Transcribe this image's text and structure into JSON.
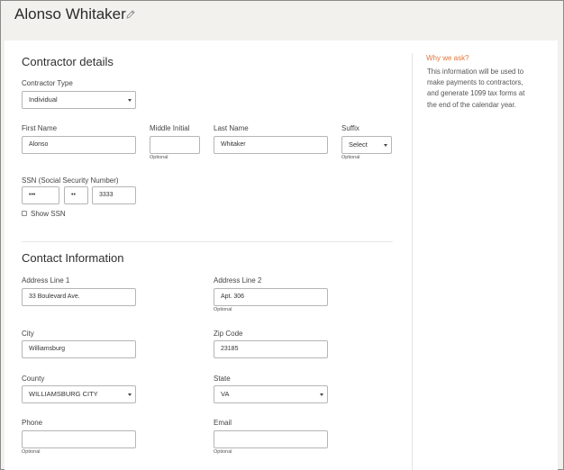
{
  "header": {
    "name": "Alonso Whitaker",
    "edit_icon": "pencil-icon"
  },
  "contractor": {
    "title": "Contractor details",
    "type_label": "Contractor Type",
    "type_value": "Individual",
    "first_name_label": "First Name",
    "first_name_value": "Alonso",
    "middle_initial_label": "Middle Initial",
    "middle_initial_value": "",
    "middle_initial_hint": "Optional",
    "last_name_label": "Last Name",
    "last_name_value": "Whitaker",
    "suffix_label": "Suffix",
    "suffix_value": "Select",
    "suffix_hint": "Optional",
    "ssn_label": "SSN (Social Security Number)",
    "ssn_part1": "•••",
    "ssn_part2": "••",
    "ssn_part3": "3333",
    "show_ssn_label": "Show SSN"
  },
  "contact": {
    "title": "Contact Information",
    "address1_label": "Address Line 1",
    "address1_value": "33 Boulevard Ave.",
    "address2_label": "Address Line 2",
    "address2_value": "Apt. 306",
    "address2_hint": "Optional",
    "city_label": "City",
    "city_value": "Williamsburg",
    "zip_label": "Zip Code",
    "zip_value": "23185",
    "county_label": "County",
    "county_value": "WILLIAMSBURG CITY",
    "state_label": "State",
    "state_value": "VA",
    "phone_label": "Phone",
    "phone_value": "",
    "phone_hint": "Optional",
    "email_label": "Email",
    "email_value": "",
    "email_hint": "Optional"
  },
  "sidebar": {
    "title": "Why we ask?",
    "text": "This information will be used to make payments to contractors, and generate 1099 tax forms at the end of the calendar year."
  },
  "colors": {
    "accent": "#e0753a",
    "header_bg": "#f3f1ee"
  }
}
